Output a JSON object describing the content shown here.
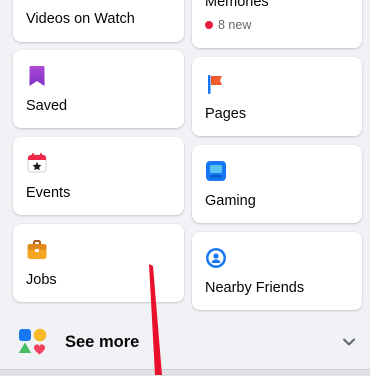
{
  "shortcuts": {
    "videos_on_watch": "Videos on Watch",
    "memories": "Memories",
    "memories_badge": "8 new",
    "saved": "Saved",
    "pages": "Pages",
    "events": "Events",
    "gaming": "Gaming",
    "jobs": "Jobs",
    "nearby_friends": "Nearby Friends"
  },
  "see_more": {
    "label": "See more"
  },
  "icons": {
    "saved": "bookmark-icon",
    "pages": "flag-icon",
    "events": "calendar-star-icon",
    "gaming": "gaming-icon",
    "jobs": "briefcase-icon",
    "nearby_friends": "location-ring-icon",
    "see_more": "shapes-icon",
    "chevron": "chevron-down-icon"
  },
  "colors": {
    "accent_blue": "#1877f2",
    "badge_red": "#e41e3f",
    "annotation_arrow": "#e8102b"
  }
}
